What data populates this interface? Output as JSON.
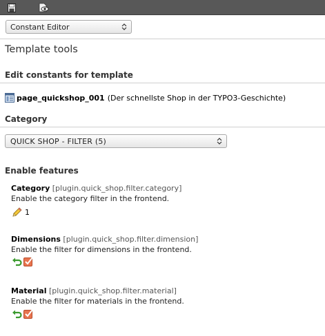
{
  "toolbar": {
    "save_icon": "save-disk-icon",
    "view_icon": "view-page-icon"
  },
  "function_menu": {
    "selected": "Constant Editor"
  },
  "page": {
    "title": "Template tools"
  },
  "edit_section": {
    "heading": "Edit constants for template",
    "template_name": "page_quickshop_001",
    "template_description": "(Der schnellste Shop in der TYPO3-Geschichte)"
  },
  "category": {
    "heading": "Category",
    "selected": "QUICK SHOP - FILTER (5)"
  },
  "features": {
    "heading": "Enable features",
    "items": [
      {
        "label": "Category",
        "key": "[plugin.quick_shop.filter.category]",
        "description": "Enable the category filter in the frontend.",
        "value": "1",
        "edit_icon": "pencil-icon"
      },
      {
        "label": "Dimensions",
        "key": "[plugin.quick_shop.filter.dimension]",
        "description": "Enable the filter for dimensions in the frontend.",
        "reset_icon": "undo-arrow-icon",
        "checkbox_checked": true
      },
      {
        "label": "Material",
        "key": "[plugin.quick_shop.filter.material]",
        "description": "Enable the filter for materials in the frontend.",
        "reset_icon": "undo-arrow-icon",
        "checkbox_checked": true
      }
    ]
  },
  "colors": {
    "topbar": "#585858",
    "heading": "#333333",
    "checkbox": "#e8744f",
    "undo_arrow": "#3a9a2e"
  }
}
